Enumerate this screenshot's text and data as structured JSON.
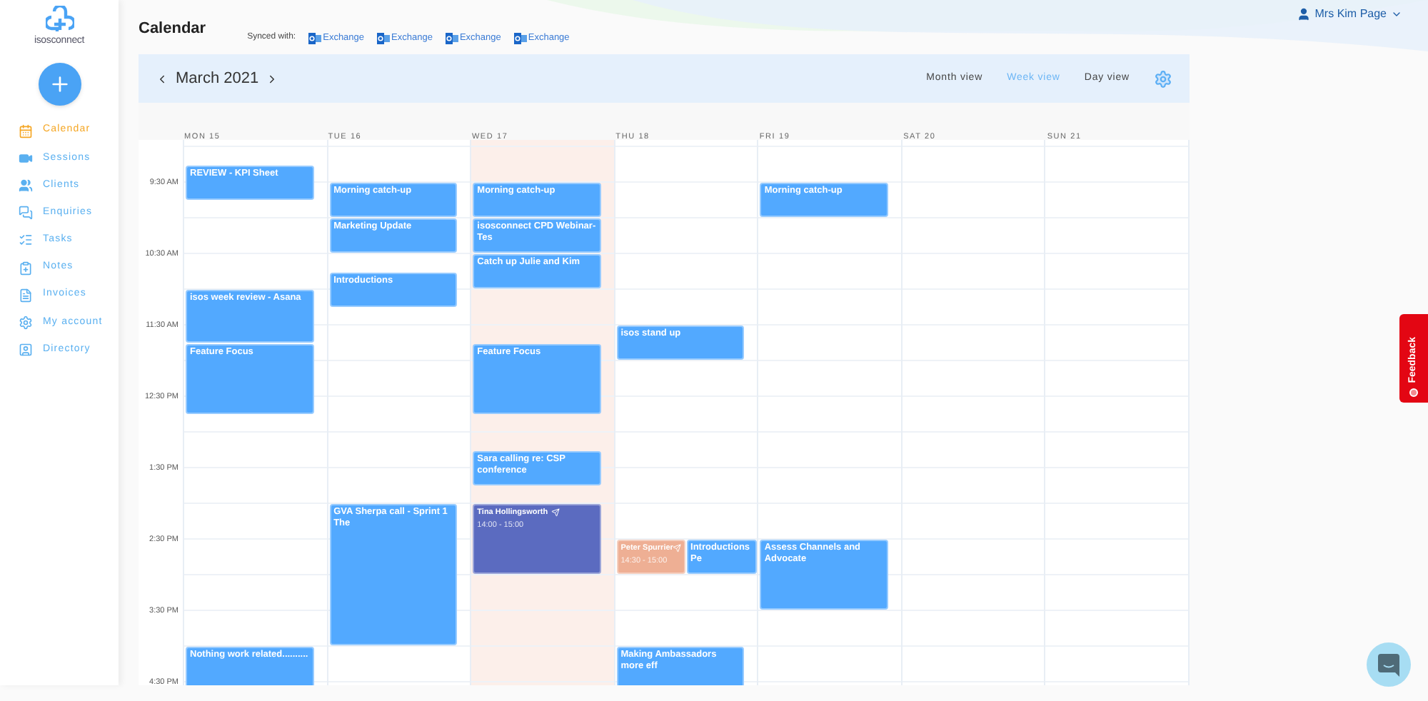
{
  "logo": {
    "text": "isosconnect"
  },
  "sidebar": {
    "items": [
      {
        "label": "Calendar",
        "selected": true
      },
      {
        "label": "Sessions",
        "selected": false
      },
      {
        "label": "Clients",
        "selected": false
      },
      {
        "label": "Enquiries",
        "selected": false
      },
      {
        "label": "Tasks",
        "selected": false
      },
      {
        "label": "Notes",
        "selected": false
      },
      {
        "label": "Invoices",
        "selected": false
      },
      {
        "label": "My account",
        "selected": false
      },
      {
        "label": "Directory",
        "selected": false
      }
    ]
  },
  "page": {
    "title": "Calendar"
  },
  "sync": {
    "label": "Synced with:",
    "accounts": [
      "Exchange",
      "Exchange",
      "Exchange",
      "Exchange"
    ]
  },
  "user": {
    "name": "Mrs Kim Page"
  },
  "calendar": {
    "month": "March 2021",
    "views": [
      {
        "label": "Month view",
        "selected": false
      },
      {
        "label": "Week view",
        "selected": true
      },
      {
        "label": "Day view",
        "selected": false
      }
    ],
    "times": [
      "9:30 AM",
      "10:30 AM",
      "11:30 AM",
      "12:30 PM",
      "1:30 PM",
      "2:30 PM",
      "3:30 PM",
      "4:30 PM"
    ],
    "days": [
      {
        "label": "MON 15",
        "today": false,
        "events": [
          {
            "title": "REVIEW - KPI Sheet",
            "kind": "event",
            "color": "#52a9ff"
          },
          {
            "title": "isos week review - Asana",
            "kind": "event",
            "color": "#52a9ff"
          },
          {
            "title": "Feature Focus",
            "kind": "event",
            "color": "#52a9ff"
          },
          {
            "title": "Nothing work related..........",
            "kind": "event",
            "color": "#52a9ff"
          }
        ]
      },
      {
        "label": "TUE 16",
        "today": false,
        "events": [
          {
            "title": "Morning catch-up",
            "kind": "event",
            "color": "#52a9ff"
          },
          {
            "title": "Marketing Update",
            "kind": "event",
            "color": "#52a9ff"
          },
          {
            "title": "Introductions",
            "kind": "event",
            "color": "#52a9ff"
          },
          {
            "title": "GVA Sherpa call - Sprint 1 The",
            "kind": "event",
            "color": "#52a9ff"
          }
        ]
      },
      {
        "label": "WED 17",
        "today": true,
        "events": [
          {
            "title": "Morning catch-up",
            "kind": "event",
            "color": "#52a9ff"
          },
          {
            "title": "isosconnect CPD Webinar- Tes",
            "kind": "event",
            "color": "#52a9ff"
          },
          {
            "title": "Catch up Julie and Kim",
            "kind": "event",
            "color": "#52a9ff"
          },
          {
            "title": "Feature Focus",
            "kind": "event",
            "color": "#52a9ff"
          },
          {
            "title": "Sara calling re: CSP conference",
            "kind": "event",
            "color": "#52a9ff"
          },
          {
            "title": "Tina Hollingsworth",
            "time": "14:00 - 15:00",
            "kind": "session",
            "color": "#5b6bc0"
          }
        ]
      },
      {
        "label": "THU 18",
        "today": false,
        "events": [
          {
            "title": "isos stand up",
            "kind": "event",
            "color": "#52a9ff"
          },
          {
            "title": "Peter Spurrier",
            "time": "14:30 - 15:00",
            "kind": "session",
            "color": "#eeaf94"
          },
          {
            "title": "Introductions Pe",
            "kind": "event",
            "color": "#52a9ff"
          },
          {
            "title": "Making Ambassadors more eff",
            "kind": "event",
            "color": "#52a9ff"
          }
        ]
      },
      {
        "label": "FRI 19",
        "today": false,
        "events": [
          {
            "title": "Morning catch-up",
            "kind": "event",
            "color": "#52a9ff"
          },
          {
            "title": "Assess Channels and Advocate",
            "kind": "event",
            "color": "#52a9ff"
          }
        ]
      },
      {
        "label": "SAT 20",
        "today": false
      },
      {
        "label": "SUN 21",
        "today": false
      }
    ]
  },
  "feedback": {
    "label": "Feedback"
  }
}
